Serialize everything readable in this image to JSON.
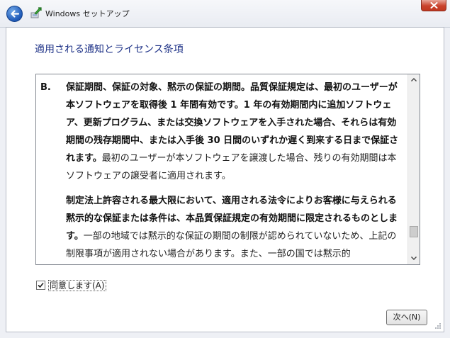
{
  "window": {
    "title": "Windows セットアップ"
  },
  "page": {
    "title": "適用される通知とライセンス条項"
  },
  "license": {
    "section_letter": "B.",
    "paragraph1_bold": "保証期間、保証の対象、黙示の保証の期間。品質保証規定は、最初のユーザーが本ソフトウェアを取得後 1 年間有効です。1 年の有効期間内に追加ソフトウェア、更新プログラム、または交換ソフトウェアを入手された場合、それらは有効期間の残存期間中、または入手後 30 日間のいずれか遅く到来する日まで保証されます。",
    "paragraph1_normal": "最初のユーザーが本ソフトウェアを譲渡した場合、残りの有効期間は本ソフトウェアの譲受者に適用されます。",
    "paragraph2_bold": "制定法上許容される最大限において、適用される法令によりお客様に与えられる黙示的な保証または条件は、本品質保証規定の有効期間に限定されるものとします。",
    "paragraph2_normal": "一部の地域では黙示的な保証の期間の制限が認められていないため、上記の制限事項が適用されない場合があります。また、一部の国では黙示的"
  },
  "accept": {
    "label": "同意します(A)",
    "checked": true
  },
  "buttons": {
    "next_label": "次へ(N)"
  },
  "colors": {
    "title_blue": "#1e3287",
    "window_background": "#eef0f5",
    "close_red": "#c9422c"
  },
  "icons": {
    "back": "back-arrow-icon",
    "setup": "windows-setup-icon",
    "close": "close-icon"
  }
}
